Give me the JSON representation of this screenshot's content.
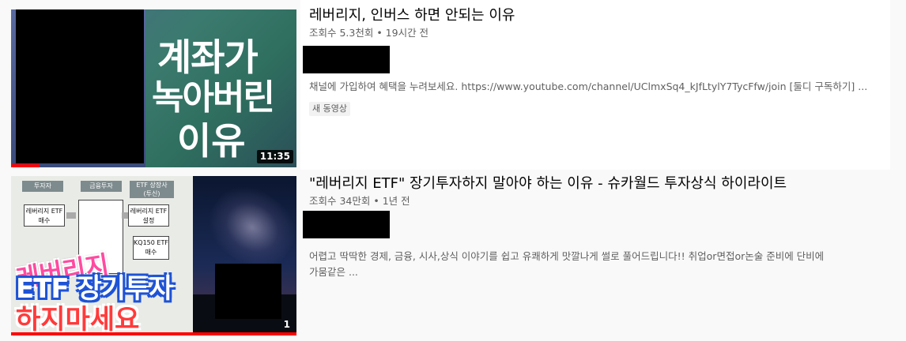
{
  "videos": [
    {
      "title": "레버리지, 인버스 하면 안되는 이유",
      "meta": "조회수 5.3천회 • 19시간 전",
      "description": "채널에 가입하여 혜택을 누려보세요. https://www.youtube.com/channel/UClmxSq4_kJfLtylY7TycFfw/join [둘디 구독하기] ...",
      "badge": "새 동영상",
      "duration": "11:35",
      "watched_fraction": 0.1,
      "thumb_lines": [
        "계좌가",
        "녹아버린",
        "이유"
      ]
    },
    {
      "title": "\"레버리지 ETF\" 장기투자하지 말아야 하는 이유 - 슈카월드 투자상식 하이라이트",
      "meta": "조회수 34만회 • 1년 전",
      "description_line1": "어렵고 딱딱한 경제, 금융, 시사,상식 이야기를 쉽고 유쾌하게 맛깔나게 썰로 풀어드립니다!! 취업or면접or논술 준비에 단비에",
      "description_line2": "가뭄같은 ...",
      "duration": "1",
      "watched_fraction": 1.0,
      "thumb_lines": [
        "레버리지",
        "ETF 장기투자",
        "하지마세요"
      ],
      "diagram": {
        "col1": "투자자",
        "col2": "금융투자",
        "col3": "ETF 상장사",
        "col3_sub": "(투신)",
        "box1": "레버리지 ETF 매수",
        "box2": "레버리지 ETF 설정",
        "box3": "KQ150 ETF 매수"
      }
    }
  ]
}
